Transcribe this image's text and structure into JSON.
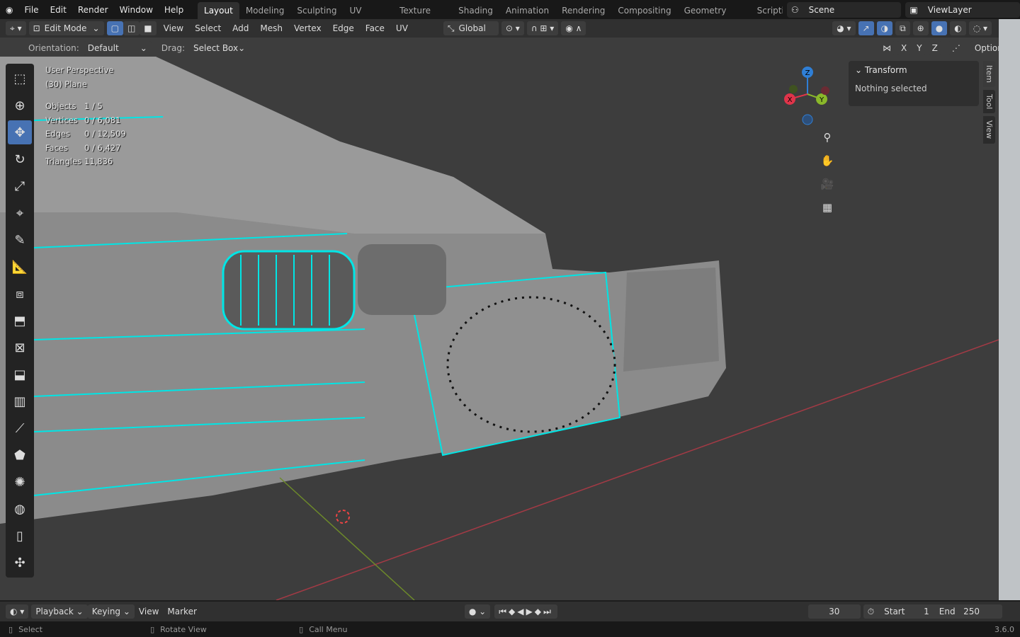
{
  "topbar": {
    "menus": [
      "File",
      "Edit",
      "Render",
      "Window",
      "Help"
    ],
    "workspaces": [
      "Layout",
      "Modeling",
      "Sculpting",
      "UV Editing",
      "Texture Paint",
      "Shading",
      "Animation",
      "Rendering",
      "Compositing",
      "Geometry Nodes",
      "Scripting"
    ],
    "active_workspace": "Layout",
    "scene": "Scene",
    "view_layer": "ViewLayer"
  },
  "header": {
    "mode": "Edit Mode",
    "menus": [
      "View",
      "Select",
      "Add",
      "Mesh",
      "Vertex",
      "Edge",
      "Face",
      "UV"
    ],
    "transform_orientation": "Global"
  },
  "tool_options": {
    "orientation_label": "Orientation:",
    "orientation": "Default",
    "drag_label": "Drag:",
    "drag": "Select Box",
    "axes": [
      "X",
      "Y",
      "Z"
    ],
    "options": "Options"
  },
  "overlay": {
    "perspective": "User Perspective",
    "object": "(30) Plane",
    "stats": [
      {
        "k": "Objects",
        "v": "1 / 5"
      },
      {
        "k": "Vertices",
        "v": "0 / 6,081"
      },
      {
        "k": "Edges",
        "v": "0 / 12,509"
      },
      {
        "k": "Faces",
        "v": "0 / 6,427"
      },
      {
        "k": "Triangles",
        "v": "11,836"
      }
    ]
  },
  "npanel": {
    "title": "Transform",
    "message": "Nothing selected",
    "tabs": [
      "Item",
      "Tool",
      "View"
    ]
  },
  "gizmo": {
    "x": "X",
    "y": "Y",
    "z": "Z"
  },
  "timeline": {
    "menus": [
      "Playback",
      "Keying",
      "View",
      "Marker"
    ],
    "current_frame": "30",
    "start_label": "Start",
    "start": "1",
    "end_label": "End",
    "end": "250"
  },
  "status": {
    "select": "Select",
    "rotate": "Rotate View",
    "call_menu": "Call Menu",
    "version": "3.6.0"
  },
  "colors": {
    "accent": "#4772b3",
    "wire": "#00e5e5",
    "x_axis": "#e0344a",
    "y_axis": "#8ab82a",
    "z_axis": "#2f7fd6"
  }
}
